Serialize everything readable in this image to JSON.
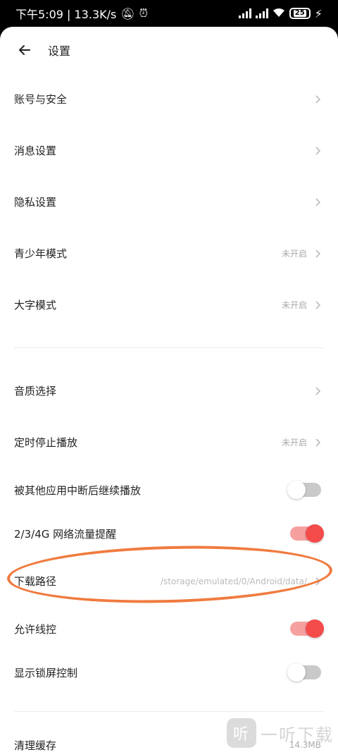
{
  "status": {
    "time_speed": "下午5:09 | 13.3K/s",
    "battery": "25"
  },
  "header": {
    "title": "设置"
  },
  "rows": {
    "account": {
      "label": "账号与安全"
    },
    "message": {
      "label": "消息设置"
    },
    "privacy": {
      "label": "隐私设置"
    },
    "teen": {
      "label": "青少年模式",
      "status": "未开启"
    },
    "bigfont": {
      "label": "大字模式",
      "status": "未开启"
    },
    "quality": {
      "label": "音质选择"
    },
    "timer": {
      "label": "定时停止播放",
      "status": "未开启"
    },
    "resume": {
      "label": "被其他应用中断后继续播放",
      "on": false
    },
    "mobile": {
      "label": "2/3/4G 网络流量提醒",
      "on": true
    },
    "download": {
      "label": "下载路径",
      "path": "/storage/emulated/0/Android/data/"
    },
    "wired": {
      "label": "允许线控",
      "on": true
    },
    "lockscreen": {
      "label": "显示锁屏控制",
      "on": false
    },
    "cache": {
      "label": "清理缓存",
      "size": "14.3MB"
    }
  },
  "watermark": {
    "text": "一听下载",
    "logo": "听"
  },
  "colors": {
    "accent": "#f44b4b",
    "annotation": "#f07b3f"
  }
}
